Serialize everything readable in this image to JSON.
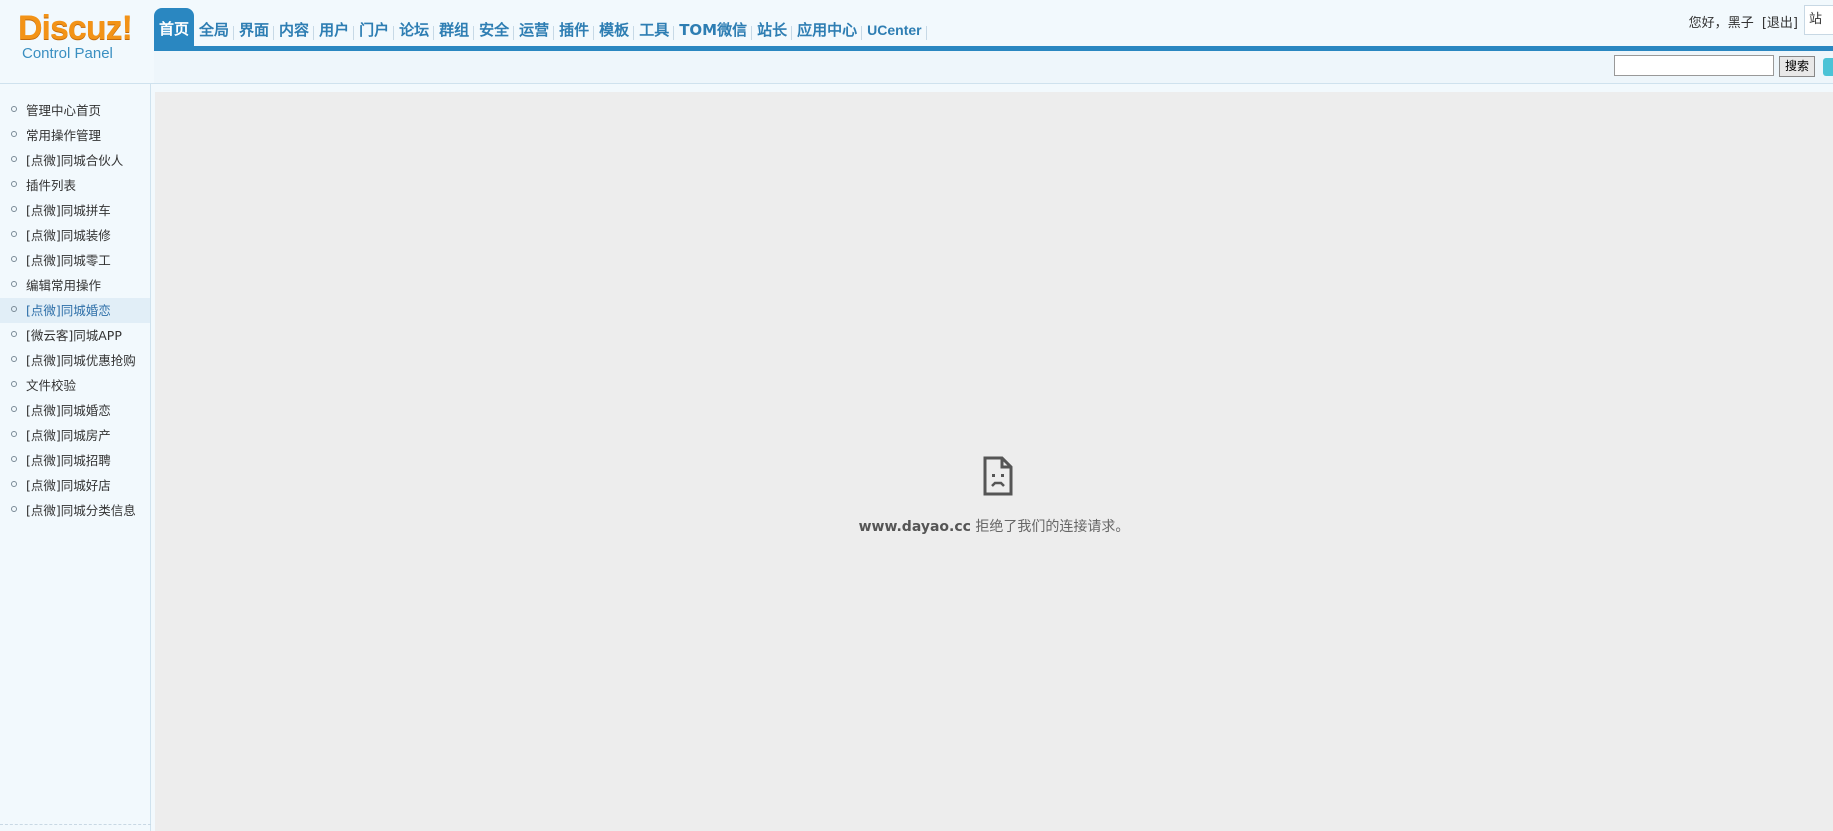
{
  "logo": {
    "brand": "Discuz!",
    "sub": "Control Panel"
  },
  "topnav": [
    "首页",
    "全局",
    "界面",
    "内容",
    "用户",
    "门户",
    "论坛",
    "群组",
    "安全",
    "运营",
    "插件",
    "模板",
    "工具",
    "TOM微信",
    "站长",
    "应用中心",
    "UCenter"
  ],
  "user": {
    "greeting": "您好，",
    "name": "黑子",
    "logout": "[退出]",
    "site_box": "站点"
  },
  "search": {
    "value": "",
    "button": "搜索"
  },
  "sidebar": [
    "管理中心首页",
    "常用操作管理",
    "[点微]同城合伙人",
    "插件列表",
    "[点微]同城拼车",
    "[点微]同城装修",
    "[点微]同城零工",
    "编辑常用操作",
    "[点微]同城婚恋",
    "[微云客]同城APP",
    "[点微]同城优惠抢购",
    "文件校验",
    "[点微]同城婚恋",
    "[点微]同城房产",
    "[点微]同城招聘",
    "[点微]同城好店",
    "[点微]同城分类信息"
  ],
  "sidebar_active_index": 8,
  "error": {
    "host": "www.dayao.cc",
    "message": "拒绝了我们的连接请求。"
  },
  "colors": {
    "accent": "#2a87c1",
    "logo": "#f39317",
    "nav_text": "#2e7eb3",
    "content_bg": "#ededed"
  }
}
